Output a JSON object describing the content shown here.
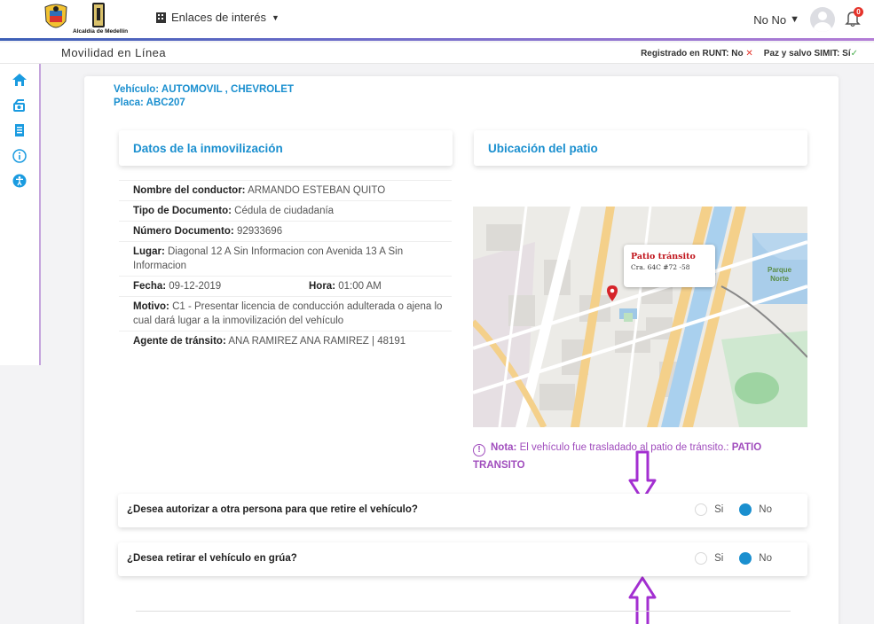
{
  "header": {
    "logo_text": "Alcaldía de Medellín",
    "links_label": "Enlaces de interés",
    "user_name": "No No",
    "notification_count": "0"
  },
  "subheader": {
    "title": "Movilidad en Línea",
    "runt_label": "Registrado en RUNT: No",
    "runt_mark": "✕",
    "simit_label": "Paz y salvo SIMIT: Sí",
    "simit_mark": "✓"
  },
  "sidebar": {
    "icons": [
      "home-icon",
      "vehicle-icon",
      "document-icon",
      "info-icon",
      "accessibility-icon"
    ]
  },
  "vehicle": {
    "line1": "Vehículo: AUTOMOVIL , CHEVROLET",
    "line2": "Placa: ABC207"
  },
  "sections": {
    "details_title": "Datos de la inmovilización",
    "location_title": "Ubicación del patio"
  },
  "details": {
    "driver_label": "Nombre del conductor:",
    "driver_value": "ARMANDO ESTEBAN QUITO",
    "doctype_label": "Tipo de Documento:",
    "doctype_value": "Cédula de ciudadanía",
    "docnum_label": "Número Documento:",
    "docnum_value": "92933696",
    "place_label": "Lugar:",
    "place_value": "Diagonal 12 A Sin Informacion con Avenida 13 A Sin Informacion",
    "date_label": "Fecha:",
    "date_value": "09-12-2019",
    "time_label": "Hora:",
    "time_value": "01:00 AM",
    "reason_label": "Motivo:",
    "reason_value": "C1 - Presentar licencia de conducción adulterada o ajena lo cual dará lugar a la inmovilización del vehículo",
    "agent_label": "Agente de tránsito:",
    "agent_value": "ANA RAMIREZ ANA RAMIREZ | 48191"
  },
  "map": {
    "callout_title": "Patio tránsito",
    "callout_address": "Cra. 64C #72 -58",
    "park_label_1": "Parque",
    "park_label_2": "Norte"
  },
  "note": {
    "label": "Nota:",
    "text": "El vehículo fue trasladado al patio de tránsito.:",
    "strong": "PATIO TRANSITO"
  },
  "questions": [
    {
      "text": "¿Desea autorizar a otra persona para que retire el vehículo?",
      "yes": "Si",
      "no": "No",
      "selected": "No"
    },
    {
      "text": "¿Desea retirar el vehículo en grúa?",
      "yes": "Si",
      "no": "No",
      "selected": "No"
    }
  ],
  "colors": {
    "accent_blue": "#1a8fcf",
    "note_purple": "#a04dbd",
    "arrow_purple": "#a32fd1",
    "error_red": "#e5342b"
  }
}
